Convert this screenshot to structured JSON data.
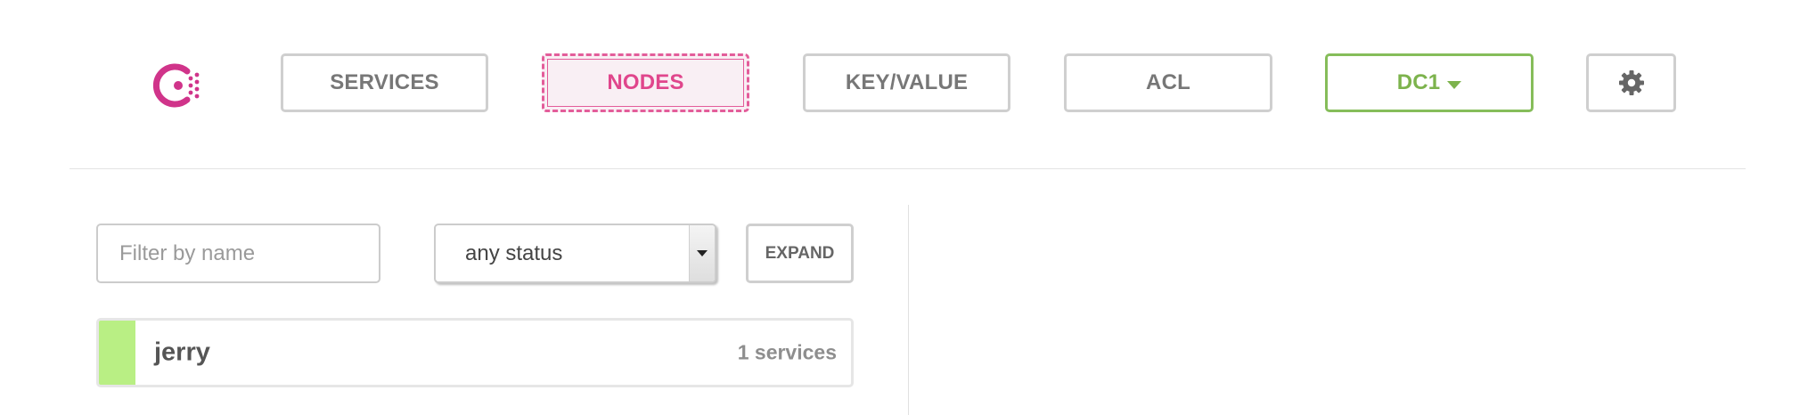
{
  "brand": {
    "logo_icon": "consul-logo-icon",
    "color": "#d0348a"
  },
  "nav": {
    "services_label": "SERVICES",
    "nodes_label": "NODES",
    "keyvalue_label": "KEY/VALUE",
    "acl_label": "ACL",
    "datacenter_label": "DC1",
    "settings_icon": "gear-icon",
    "active_tab": "NODES"
  },
  "colors": {
    "accent": "#e0468c",
    "datacenter": "#7db34d",
    "healthy_status": "#b9ef84"
  },
  "filters": {
    "name_placeholder": "Filter by name",
    "name_value": "",
    "status_selected": "any status",
    "expand_label": "EXPAND"
  },
  "nodes": [
    {
      "name": "jerry",
      "services": "1 services",
      "status": "passing"
    }
  ]
}
